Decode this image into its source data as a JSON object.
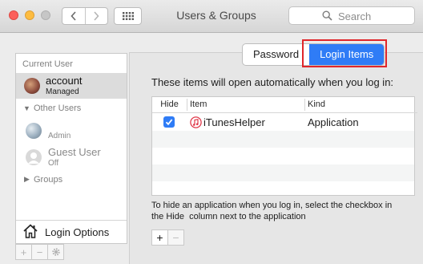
{
  "window": {
    "title": "Users & Groups"
  },
  "toolbar": {
    "back_icon": "chevron-left-icon",
    "forward_icon": "chevron-right-icon",
    "grid_icon": "grid-icon",
    "search_placeholder": "Search"
  },
  "sidebar": {
    "current_user_heading": "Current User",
    "current_user": {
      "name": "account",
      "role": "Managed"
    },
    "other_users_heading": "Other Users",
    "other_users": [
      {
        "name": "",
        "role": "Admin"
      },
      {
        "name": "Guest User",
        "role": "Off"
      }
    ],
    "groups_label": "Groups",
    "login_options_label": "Login Options",
    "buttons": [
      "+",
      "−",
      "gear-icon"
    ]
  },
  "tabs": {
    "password": "Password",
    "login_items": "Login Items",
    "active": "Login Items"
  },
  "main": {
    "intro": "These items will open automatically when you log in:",
    "columns": {
      "hide": "Hide",
      "item": "Item",
      "kind": "Kind"
    },
    "rows": [
      {
        "hide": true,
        "item": "iTunesHelper",
        "kind": "Application"
      }
    ],
    "hint_line1": "To hide an application when you log in, select the checkbox in",
    "hint_line2": "the Hide  column next to the application",
    "buttons": [
      "+",
      "−"
    ]
  },
  "colors": {
    "accent": "#2f7cf6",
    "highlight": "#e0262b"
  }
}
